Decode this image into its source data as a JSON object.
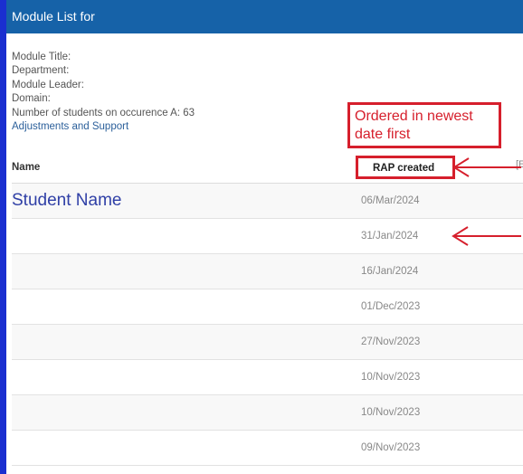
{
  "header": {
    "title": "Module List for"
  },
  "module_info": {
    "title_label": "Module Title:",
    "department_label": "Department:",
    "leader_label": "Module Leader:",
    "domain_label": "Domain:",
    "students_line": "Number of students on occurence A: 63",
    "adjustments_link": "Adjustments and Support"
  },
  "annotation": {
    "note": "Ordered in newest date first"
  },
  "table": {
    "col_name": "Name",
    "col_rap": "RAP created",
    "col_extra": "[E",
    "rows": [
      {
        "name": "Student Name",
        "date": "06/Mar/2024"
      },
      {
        "name": "",
        "date": "31/Jan/2024"
      },
      {
        "name": "",
        "date": "16/Jan/2024"
      },
      {
        "name": "",
        "date": "01/Dec/2023"
      },
      {
        "name": "",
        "date": "27/Nov/2023"
      },
      {
        "name": "",
        "date": "10/Nov/2023"
      },
      {
        "name": "",
        "date": "10/Nov/2023"
      },
      {
        "name": "",
        "date": "09/Nov/2023"
      }
    ]
  },
  "colors": {
    "header_bg": "#1662a8",
    "accent_bar": "#1a2fd0",
    "annotation_red": "#d61f2c",
    "student_name": "#2f3fa6"
  }
}
